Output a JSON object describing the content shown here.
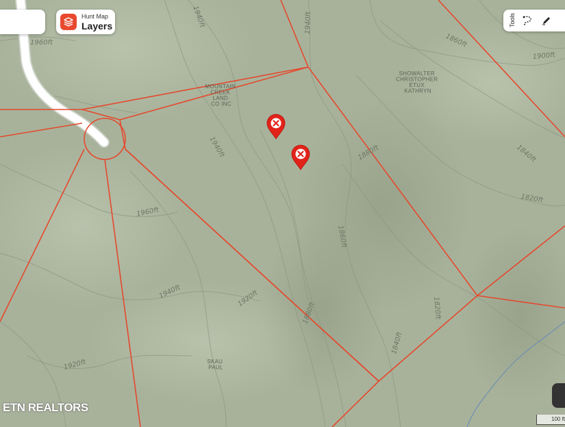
{
  "header": {
    "layers_small_label": "Hunt Map",
    "layers_label": "Layers",
    "tools_label": "Tools"
  },
  "map": {
    "contour_labels": [
      "1940ft",
      "1940ft",
      "1960ft",
      "1860ft",
      "1900ft",
      "1940ft",
      "1880ft",
      "1840ft",
      "1820ft",
      "1960ft",
      "1860ft",
      "1940ft",
      "1920ft",
      "1880ft",
      "1820ft",
      "1840ft",
      "1920ft"
    ],
    "parcels": {
      "mountain_creek": "MOUNTAIN CREEK LAND CO INC",
      "showalter": "SHOWALTER CHRISTOPHER ETUX KATHRYN",
      "skau": "SKAU PAUL"
    },
    "pins": [
      {
        "name": "pin-1"
      },
      {
        "name": "pin-2"
      }
    ],
    "scale_label": "100 ft",
    "colors": {
      "terrain": "#a9b39c",
      "parcel_line": "#e5482c",
      "pin": "#e2231a",
      "road": "#ffffff"
    }
  },
  "watermark": "ETN REALTORS"
}
